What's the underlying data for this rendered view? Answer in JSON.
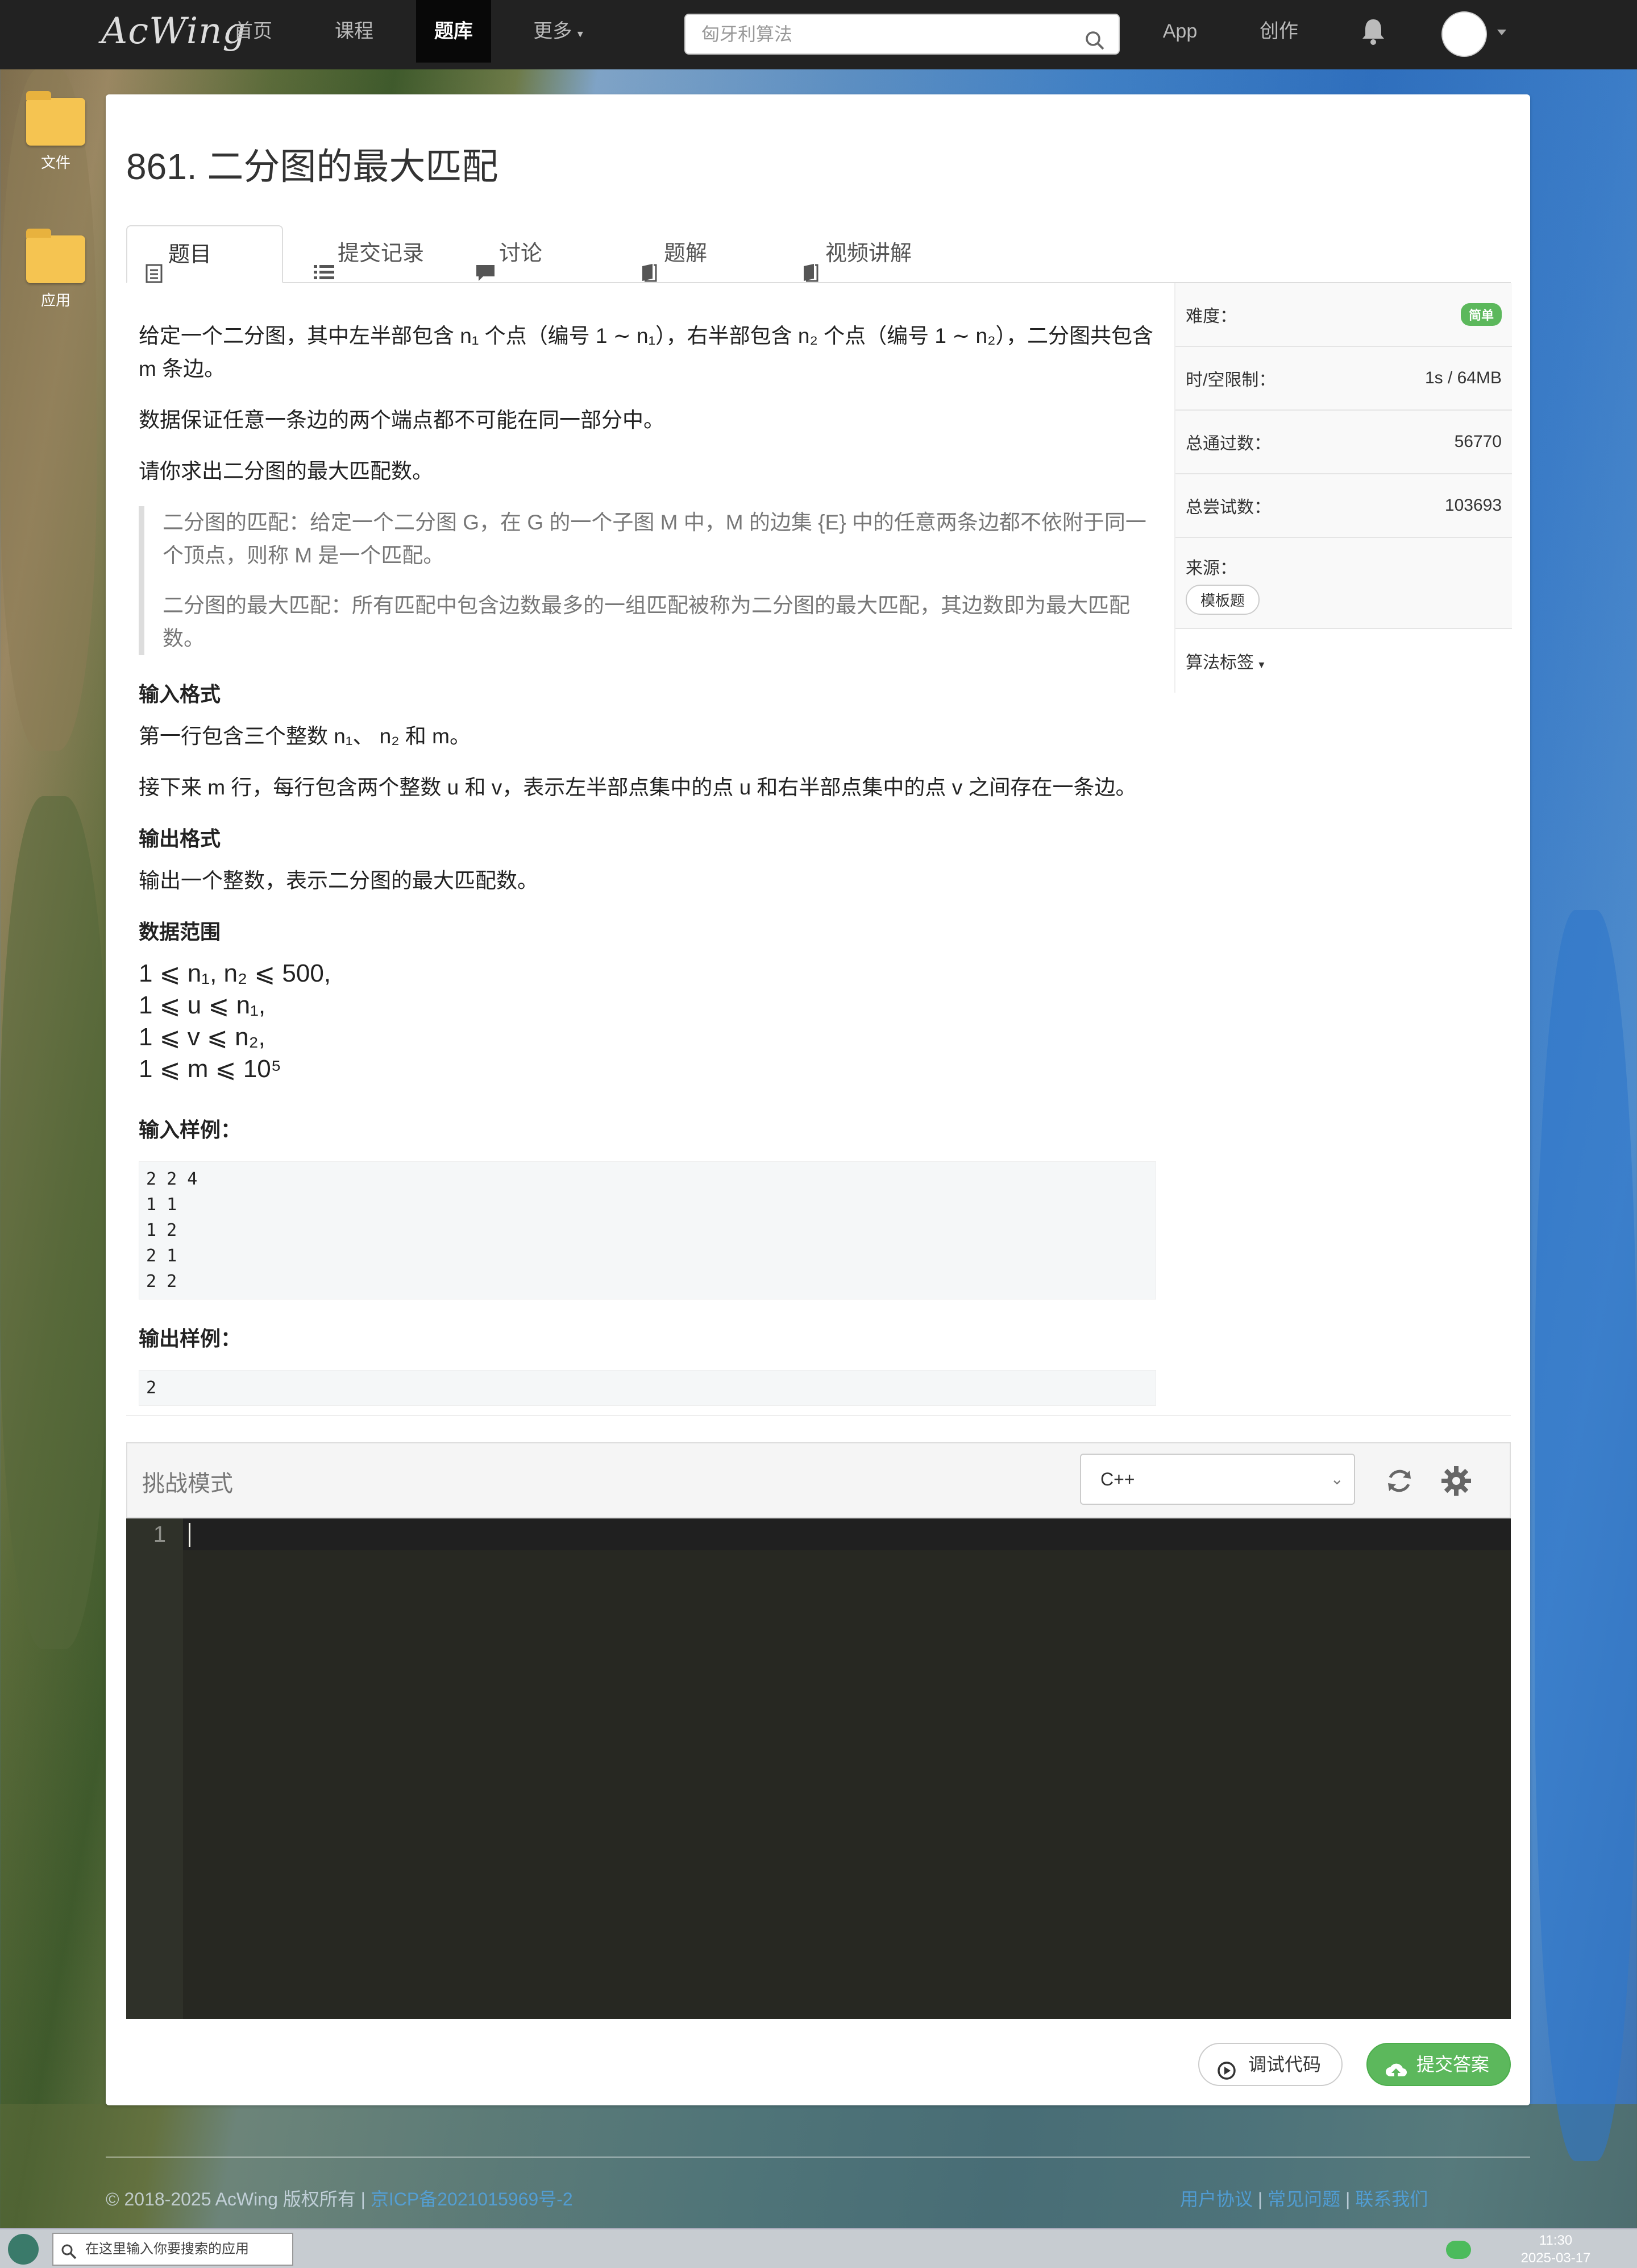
{
  "navbar": {
    "logo": "AcWing",
    "items": [
      {
        "label": "首页"
      },
      {
        "label": "课程"
      },
      {
        "label": "题库"
      },
      {
        "label": "更多"
      }
    ],
    "search_placeholder": "匈牙利算法",
    "app_label": "App",
    "create_label": "创作"
  },
  "desktop": {
    "icons": [
      {
        "label": "文件"
      },
      {
        "label": "应用"
      }
    ]
  },
  "problem": {
    "title": "861. 二分图的最大匹配",
    "tabs": [
      {
        "label": "题目"
      },
      {
        "label": "提交记录"
      },
      {
        "label": "讨论"
      },
      {
        "label": "题解"
      },
      {
        "label": "视频讲解"
      }
    ],
    "para1": "给定一个二分图，其中左半部包含 n₁ 个点（编号 1 ∼ n₁），右半部包含 n₂ 个点（编号 1 ∼ n₂），二分图共包含 m 条边。",
    "para2": "数据保证任意一条边的两个端点都不可能在同一部分中。",
    "para3": "请你求出二分图的最大匹配数。",
    "quote1": "二分图的匹配：给定一个二分图 G，在 G 的一个子图 M 中，M 的边集 {E} 中的任意两条边都不依附于同一个顶点，则称 M 是一个匹配。",
    "quote2": "二分图的最大匹配：所有匹配中包含边数最多的一组匹配被称为二分图的最大匹配，其边数即为最大匹配数。",
    "input_heading": "输入格式",
    "input_line1": "第一行包含三个整数 n₁、 n₂ 和 m。",
    "input_line2": "接下来 m 行，每行包含两个整数 u 和 v，表示左半部点集中的点 u 和右半部点集中的点 v 之间存在一条边。",
    "output_heading": "输出格式",
    "output_line": "输出一个整数，表示二分图的最大匹配数。",
    "range_heading": "数据范围",
    "range": [
      "1 ⩽ n₁, n₂ ⩽ 500,",
      "1 ⩽ u ⩽ n₁,",
      "1 ⩽ v ⩽ n₂,",
      "1 ⩽ m ⩽ 10⁵"
    ],
    "sample_in_heading": "输入样例：",
    "sample_in": "2 2 4\n1 1\n1 2\n2 1\n2 2",
    "sample_out_heading": "输出样例：",
    "sample_out": "2"
  },
  "info": {
    "difficulty_label": "难度：",
    "difficulty_value": "简单",
    "limit_label": "时/空限制：",
    "limit_value": "1s / 64MB",
    "pass_label": "总通过数：",
    "pass_value": "56770",
    "try_label": "总尝试数：",
    "try_value": "103693",
    "source_label": "来源：",
    "source_value": "模板题",
    "tags_label": "算法标签"
  },
  "editor": {
    "mode_label": "挑战模式",
    "language": "C++",
    "line_number": "1",
    "debug_label": "调试代码",
    "submit_label": "提交答案"
  },
  "footer": {
    "copyright": "© 2018-2025 AcWing 版权所有",
    "icp": "京ICP备2021015969号-2",
    "links": [
      "用户协议",
      "常见问题",
      "联系我们"
    ]
  },
  "taskbar": {
    "search_placeholder": "在这里输入你要搜索的应用",
    "time": "11:30",
    "date": "2025-03-17"
  }
}
